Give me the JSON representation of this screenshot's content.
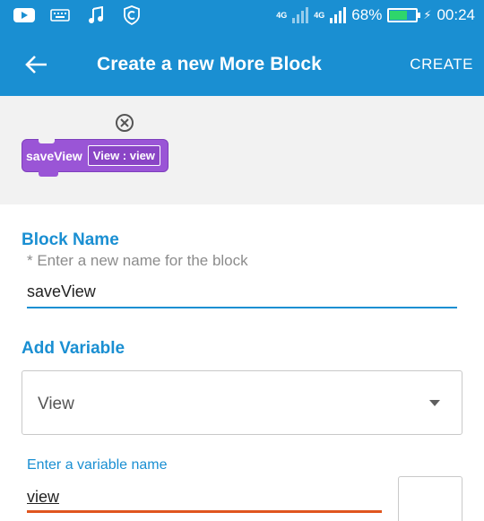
{
  "status_bar": {
    "network_1": "4G",
    "network_2": "4G",
    "battery_percent": "68%",
    "battery_level": 0.68,
    "time": "00:24"
  },
  "app_bar": {
    "title": "Create a new More Block",
    "create_label": "CREATE"
  },
  "preview": {
    "block_name": "saveView",
    "param_label": "View : view",
    "block_color": "#9a55d6"
  },
  "form": {
    "block_name_label": "Block Name",
    "block_name_hint": "* Enter a new name for the block",
    "block_name_value": "saveView",
    "add_variable_label": "Add Variable",
    "variable_type_selected": "View",
    "variable_name_label": "Enter a variable name",
    "variable_name_value": "view"
  },
  "colors": {
    "primary": "#1a8fd2",
    "error_underline": "#e0561f",
    "battery_fill": "#2ed66b"
  }
}
